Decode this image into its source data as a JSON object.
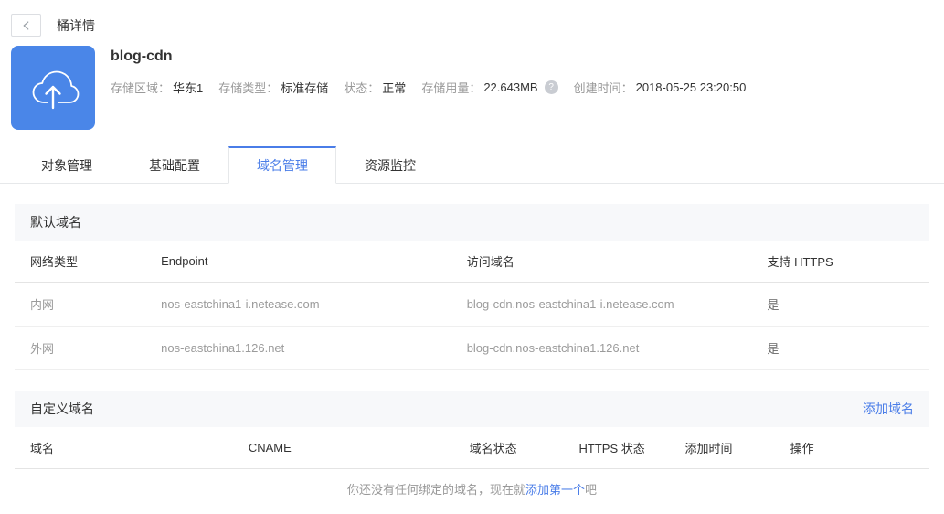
{
  "page_header": {
    "title": "桶详情"
  },
  "bucket": {
    "name": "blog-cdn",
    "info": [
      {
        "label": "存储区域：",
        "value": "华东1"
      },
      {
        "label": "存储类型：",
        "value": "标准存储"
      },
      {
        "label": "状态：",
        "value": "正常"
      },
      {
        "label": "存储用量：",
        "value": "22.643MB",
        "help": true
      },
      {
        "label": "创建时间：",
        "value": "2018-05-25 23:20:50"
      }
    ]
  },
  "tabs": [
    {
      "label": "对象管理",
      "active": false
    },
    {
      "label": "基础配置",
      "active": false
    },
    {
      "label": "域名管理",
      "active": true
    },
    {
      "label": "资源监控",
      "active": false
    }
  ],
  "default_domain": {
    "section_title": "默认域名",
    "columns": [
      "网络类型",
      "Endpoint",
      "访问域名",
      "支持 HTTPS"
    ],
    "rows": [
      [
        "内网",
        "nos-eastchina1-i.netease.com",
        "blog-cdn.nos-eastchina1-i.netease.com",
        "是"
      ],
      [
        "外网",
        "nos-eastchina1.126.net",
        "blog-cdn.nos-eastchina1.126.net",
        "是"
      ]
    ]
  },
  "custom_domain": {
    "section_title": "自定义域名",
    "add_link": "添加域名",
    "columns": [
      "域名",
      "CNAME",
      "域名状态",
      "HTTPS 状态",
      "添加时间",
      "操作"
    ],
    "empty": {
      "pre": "你还没有任何绑定的域名，现在就",
      "link": "添加第一个",
      "post": "吧"
    }
  },
  "icons": {
    "back": "chevron-left-icon",
    "bucket": "cloud-upload-icon",
    "help_glyph": "?"
  },
  "colors": {
    "accent": "#4a7de8",
    "icon_background": "#4a86e8",
    "section_bar_background": "#f7f8fa",
    "muted_text": "#9b9b9b"
  }
}
